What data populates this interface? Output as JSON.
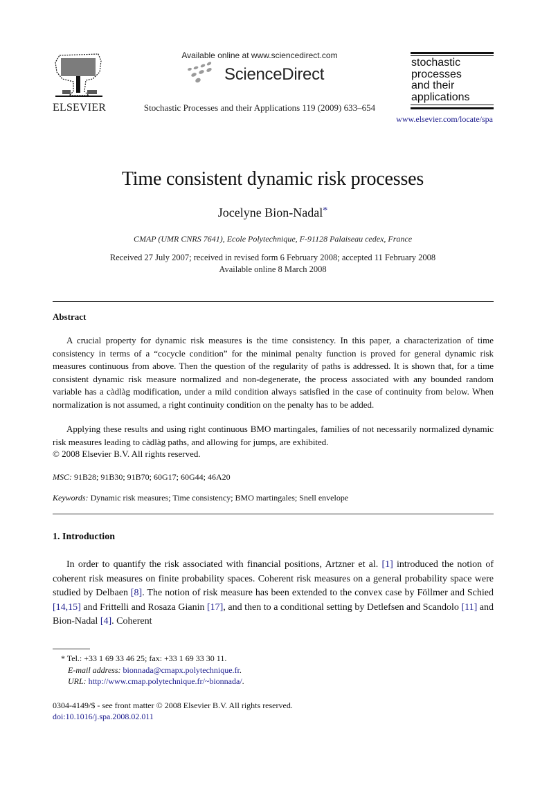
{
  "header": {
    "publisher": "ELSEVIER",
    "available_online": "Available online at www.sciencedirect.com",
    "sciencedirect": "ScienceDirect",
    "journal_ref": "Stochastic Processes and their Applications 119 (2009) 633–654",
    "journal_logo_lines": [
      "stochastic",
      "processes",
      "and their",
      "applications"
    ],
    "journal_url": "www.elsevier.com/locate/spa"
  },
  "article": {
    "title": "Time consistent dynamic risk processes",
    "author": "Jocelyne Bion-Nadal",
    "author_mark": "*",
    "affiliation": "CMAP (UMR CNRS 7641), Ecole Polytechnique, F-91128 Palaiseau cedex, France",
    "received": "Received 27 July 2007; received in revised form 6 February 2008; accepted 11 February 2008",
    "available_online": "Available online 8 March 2008"
  },
  "abstract": {
    "heading": "Abstract",
    "paragraphs": [
      "A crucial property for dynamic risk measures is the time consistency. In this paper, a characterization of time consistency in terms of a “cocycle condition” for the minimal penalty function is proved for general dynamic risk measures continuous from above. Then the question of the regularity of paths is addressed. It is shown that, for a time consistent dynamic risk measure normalized and non-degenerate, the process associated with any bounded random variable has a càdlàg modification, under a mild condition always satisfied in the case of continuity from below. When normalization is not assumed, a right continuity condition on the penalty has to be added.",
      "Applying these results and using right continuous BMO martingales, families of not necessarily normalized dynamic risk measures leading to càdlàg paths, and allowing for jumps, are exhibited."
    ],
    "copyright": "© 2008 Elsevier B.V. All rights reserved."
  },
  "msc": {
    "label": "MSC:",
    "value": "91B28; 91B30; 91B70; 60G17; 60G44; 46A20"
  },
  "keywords": {
    "label": "Keywords:",
    "value": "Dynamic risk measures; Time consistency; BMO martingales; Snell envelope"
  },
  "introduction": {
    "heading": "1.  Introduction",
    "segments": [
      {
        "text": "In order to quantify the risk associated with financial positions, Artzner et al. ",
        "cite": false
      },
      {
        "text": "[1]",
        "cite": true
      },
      {
        "text": " introduced the notion of coherent risk measures on finite probability spaces. Coherent risk measures on a general probability space were studied by Delbaen ",
        "cite": false
      },
      {
        "text": "[8]",
        "cite": true
      },
      {
        "text": ". The notion of risk measure has been extended to the convex case by Föllmer and Schied ",
        "cite": false
      },
      {
        "text": "[14,15]",
        "cite": true
      },
      {
        "text": " and Frittelli and Rosaza Gianin ",
        "cite": false
      },
      {
        "text": "[17]",
        "cite": true
      },
      {
        "text": ", and then to a conditional setting by Detlefsen and Scandolo ",
        "cite": false
      },
      {
        "text": "[11]",
        "cite": true
      },
      {
        "text": " and Bion-Nadal ",
        "cite": false
      },
      {
        "text": "[4]",
        "cite": true
      },
      {
        "text": ". Coherent",
        "cite": false
      }
    ]
  },
  "footnotes": {
    "tel": "* Tel.: +33 1 69 33 46 25; fax: +33 1 69 33 30 11.",
    "email_label": "E-mail address:",
    "email": "bionnada@cmapx.polytechnique.fr",
    "url_label": "URL:",
    "url": "http://www.cmap.polytechnique.fr/~bionnada/",
    "front_matter": "0304-4149/$ - see front matter © 2008 Elsevier B.V. All rights reserved.",
    "doi": "doi:10.1016/j.spa.2008.02.011"
  },
  "colors": {
    "link": "#1a1a8c",
    "text": "#111111",
    "logo_dots": "#9a9a9a"
  }
}
